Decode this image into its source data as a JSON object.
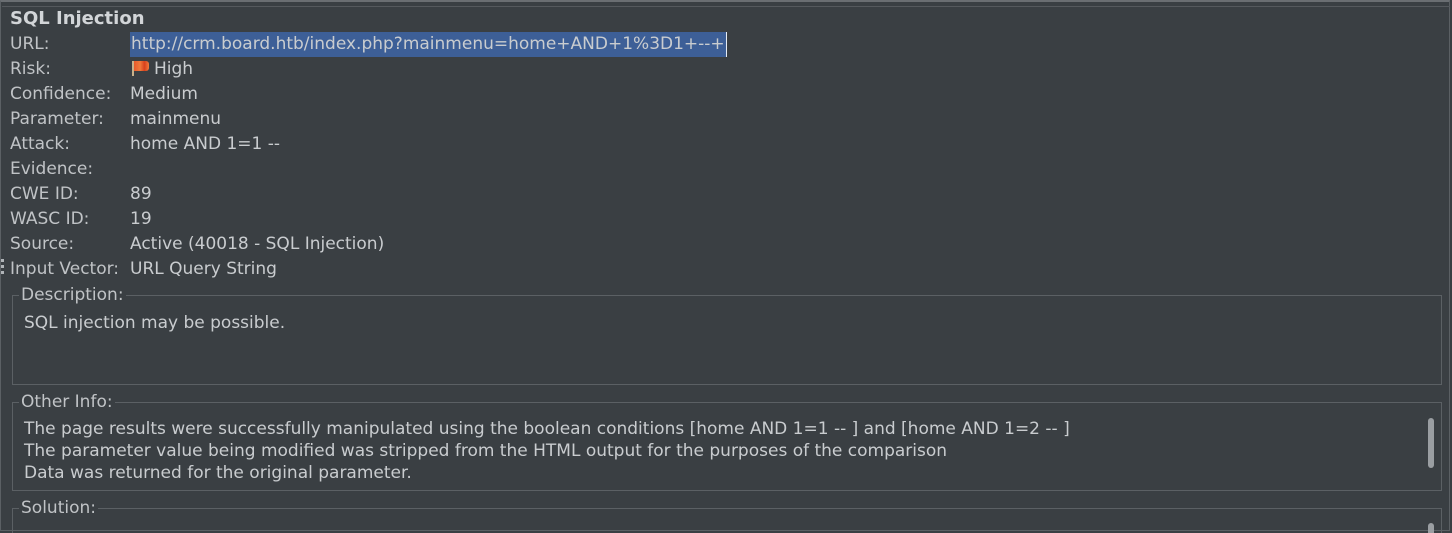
{
  "alert": {
    "title": "SQL Injection",
    "fields": {
      "url": {
        "label": "URL:",
        "value": "http://crm.board.htb/index.php?mainmenu=home+AND+1%3D1+--+"
      },
      "risk": {
        "label": "Risk:",
        "value": "High",
        "icon": "flag-icon"
      },
      "confidence": {
        "label": "Confidence:",
        "value": "Medium"
      },
      "parameter": {
        "label": "Parameter:",
        "value": "mainmenu"
      },
      "attack": {
        "label": "Attack:",
        "value": "home AND 1=1 --"
      },
      "evidence": {
        "label": "Evidence:",
        "value": ""
      },
      "cwe": {
        "label": "CWE ID:",
        "value": "89"
      },
      "wasc": {
        "label": "WASC ID:",
        "value": "19"
      },
      "source": {
        "label": "Source:",
        "value": "Active (40018 - SQL Injection)"
      },
      "input_vector": {
        "label": "Input Vector:",
        "value": "URL Query String"
      }
    },
    "description": {
      "legend": "Description:",
      "text": "SQL injection may be possible."
    },
    "other_info": {
      "legend": "Other Info:",
      "lines": [
        "The page results were successfully manipulated using the boolean conditions [home AND 1=1 -- ] and [home AND 1=2 -- ]",
        "The parameter value being modified was stripped from the HTML output for the purposes of the comparison",
        "Data was returned for the original parameter."
      ]
    },
    "solution": {
      "legend": "Solution:"
    }
  },
  "colors": {
    "background": "#3a3f43",
    "selection": "#3d5f97",
    "text": "#c9cccf",
    "border": "#5b6064"
  }
}
